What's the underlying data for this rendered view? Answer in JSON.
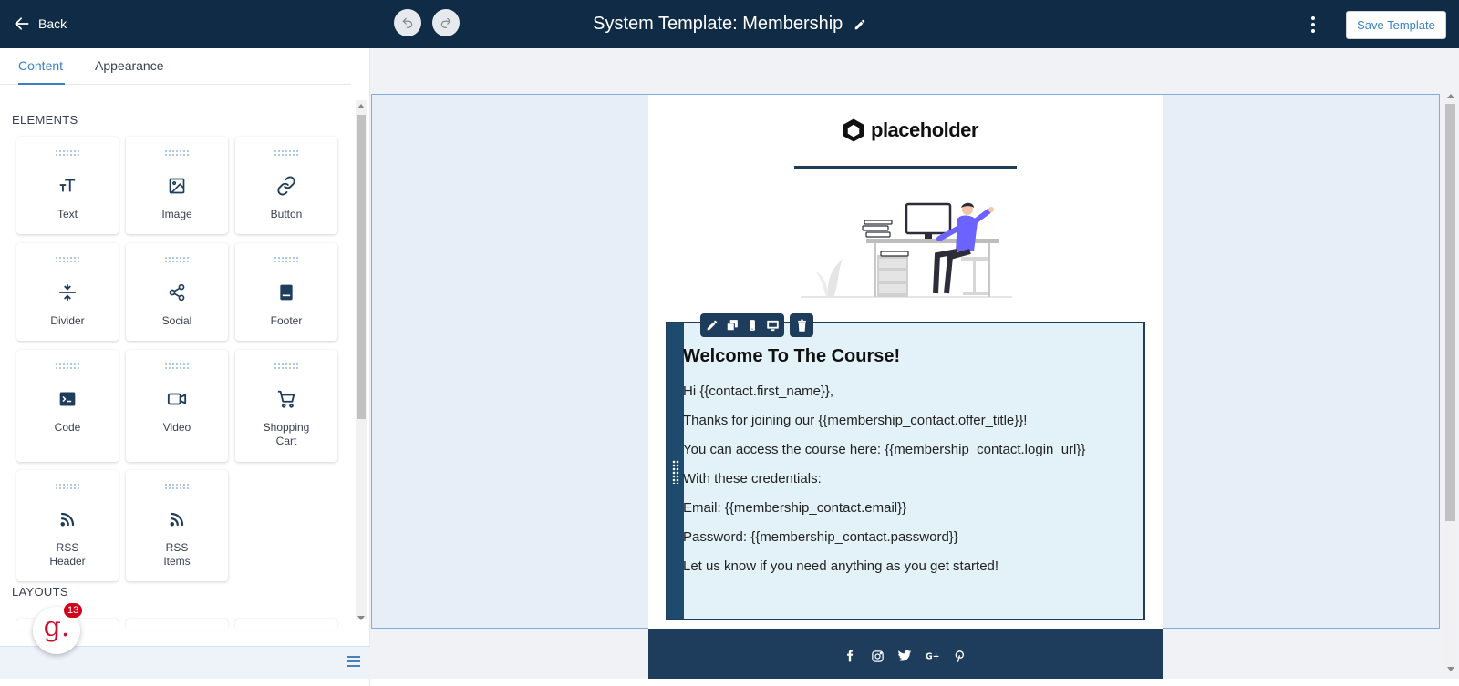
{
  "header": {
    "back_label": "Back",
    "title": "System Template: Membership",
    "save_label": "Save Template"
  },
  "left_panel": {
    "tabs": [
      {
        "label": "Content",
        "active": true
      },
      {
        "label": "Appearance",
        "active": false
      }
    ],
    "elements_heading": "ELEMENTS",
    "elements": [
      {
        "label": "Text",
        "icon": "text-icon"
      },
      {
        "label": "Image",
        "icon": "image-icon"
      },
      {
        "label": "Button",
        "icon": "link-icon"
      },
      {
        "label": "Divider",
        "icon": "divider-icon"
      },
      {
        "label": "Social",
        "icon": "share-icon"
      },
      {
        "label": "Footer",
        "icon": "footer-icon"
      },
      {
        "label": "Code",
        "icon": "terminal-icon"
      },
      {
        "label": "Video",
        "icon": "video-icon"
      },
      {
        "label": "Shopping Cart",
        "icon": "cart-icon"
      },
      {
        "label": "RSS Header",
        "icon": "rss-icon"
      },
      {
        "label": "RSS Items",
        "icon": "rss-icon"
      }
    ],
    "layouts_heading": "LAYOUTS",
    "chat_badge_count": "13"
  },
  "email": {
    "logo_text": "placeholder",
    "heading": "Welcome To The Course!",
    "lines": [
      "Hi {{contact.first_name}},",
      "Thanks for joining our {{membership_contact.offer_title}}!",
      "You can access the course here: {{membership_contact.login_url}}",
      "With these credentials:",
      "Email: {{membership_contact.email}}",
      "Password: {{membership_contact.password}}",
      "Let us know if you need anything as you get started!"
    ],
    "social_icons": [
      "facebook-icon",
      "instagram-icon",
      "twitter-icon",
      "google-plus-icon",
      "pinterest-icon"
    ]
  },
  "colors": {
    "header_bg": "#0f2b45",
    "accent_blue": "#3b7fc4",
    "email_dark": "#1e3d5c",
    "text_block_bg": "#e3f2f8"
  }
}
